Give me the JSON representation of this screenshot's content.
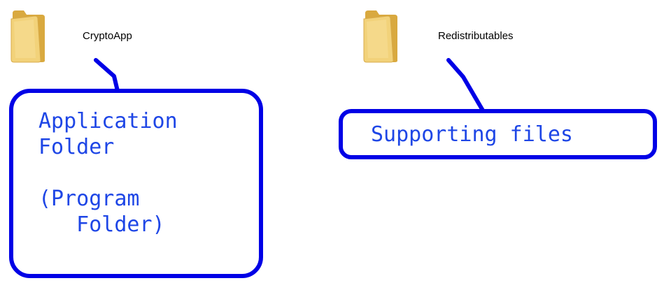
{
  "folders": [
    {
      "name": "CryptoApp"
    },
    {
      "name": "Redistributables"
    }
  ],
  "callouts": {
    "application": {
      "line1": "Application",
      "line2": "Folder",
      "line3": "",
      "line4": "(Program",
      "line5": "   Folder)"
    },
    "supporting": {
      "text": "Supporting files"
    }
  },
  "colors": {
    "callout_stroke": "#0000e6",
    "callout_text": "#1e46e6",
    "folder_body": "#f2d27a",
    "folder_back": "#d9a93f"
  }
}
